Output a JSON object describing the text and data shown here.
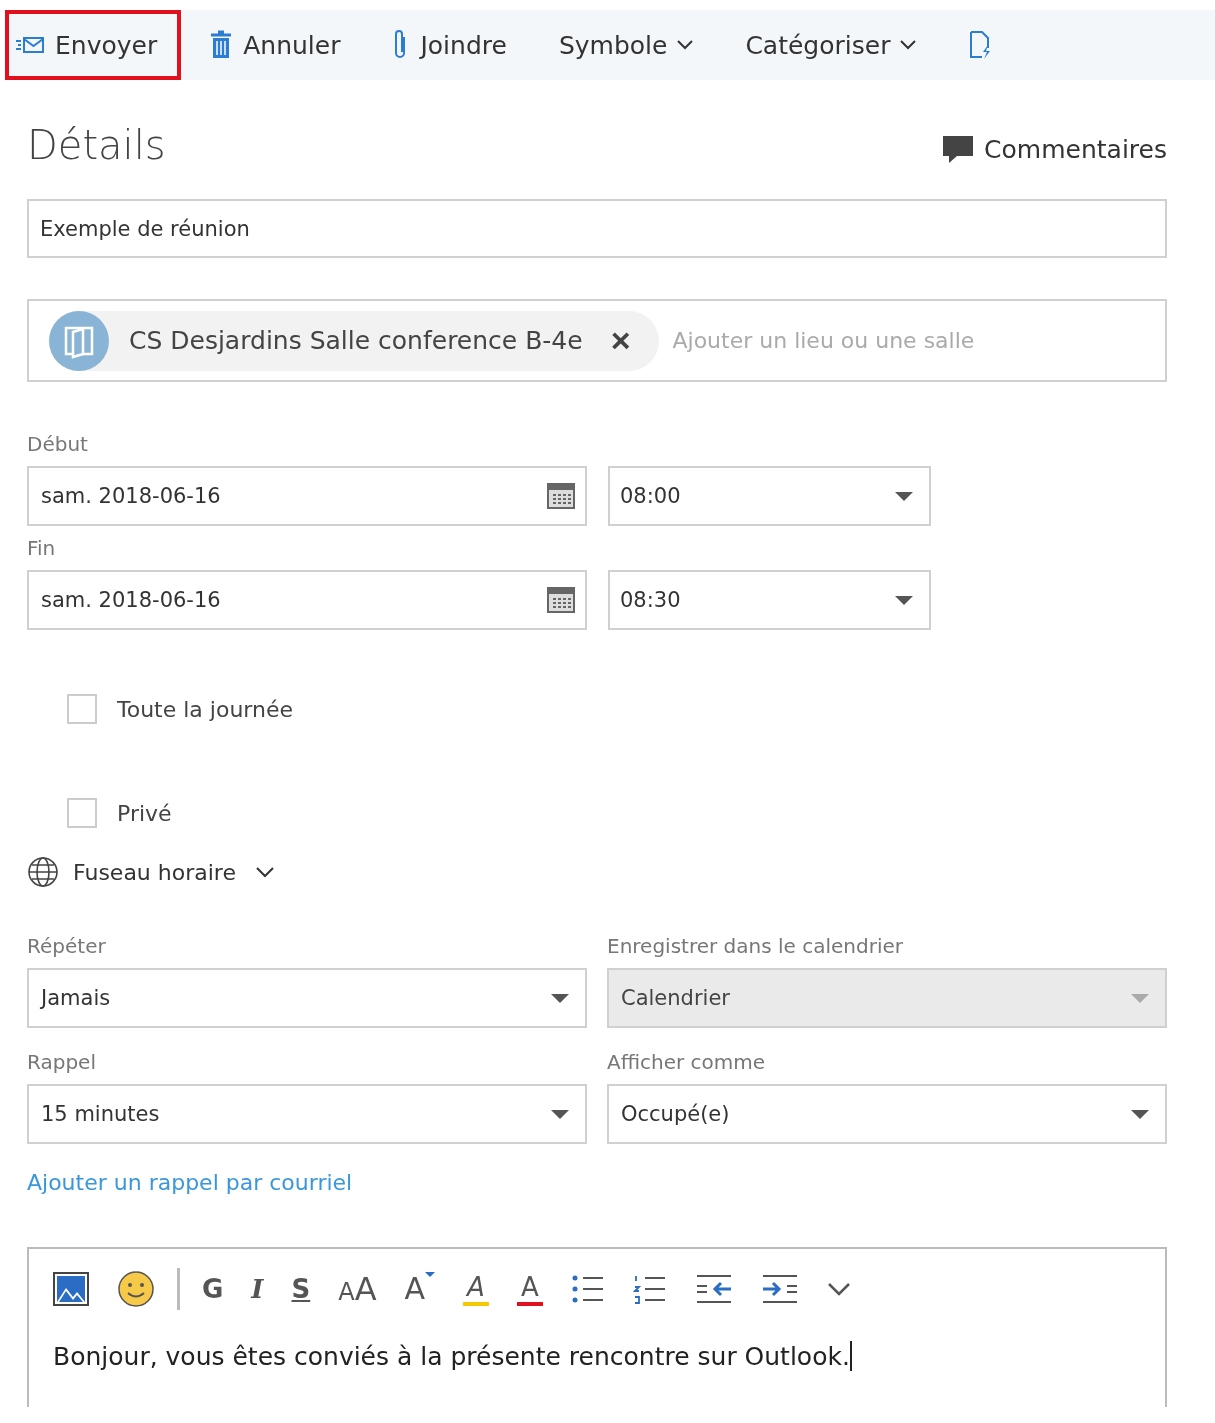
{
  "toolbar": [
    {
      "kind": "send",
      "label": "Envoyer",
      "highlighted": true
    },
    {
      "kind": "discard",
      "label": "Annuler",
      "highlighted": false
    },
    {
      "kind": "attach",
      "label": "Joindre",
      "highlighted": false
    },
    {
      "kind": "menu",
      "label": "Symbole",
      "highlighted": false
    },
    {
      "kind": "menu",
      "label": "Catégoriser",
      "highlighted": false
    },
    {
      "kind": "addin",
      "highlighted": false
    }
  ],
  "details": {
    "title": "Détails",
    "comments": "Commentaires"
  },
  "subject": {
    "value": "Exemple de réunion"
  },
  "location": {
    "chip": "CS Desjardins Salle conference B-4e",
    "remove": "×",
    "placeholder": "Ajouter un lieu ou une salle"
  },
  "start": {
    "label": "Début",
    "date": "sam. 2018-06-16",
    "time": "08:00"
  },
  "end": {
    "label": "Fin",
    "date": "sam. 2018-06-16",
    "time": "08:30"
  },
  "checkboxes": [
    {
      "label": "Toute la journée",
      "checked": false
    },
    {
      "label": "Privé",
      "checked": false
    }
  ],
  "timezone": {
    "label": "Fuseau horaire"
  },
  "selects": [
    {
      "label": "Répéter",
      "value": "Jamais",
      "disabled": false
    },
    {
      "label": "Enregistrer dans le calendrier",
      "value": "Calendrier",
      "disabled": true
    },
    {
      "label": "Rappel",
      "value": "15 minutes",
      "disabled": false
    },
    {
      "label": "Afficher comme",
      "value": "Occupé(e)",
      "disabled": false
    }
  ],
  "email_reminder_link": "Ajouter un rappel par courriel",
  "editor": {
    "insert_tools": [
      {
        "kind": "image"
      },
      {
        "kind": "emoji"
      }
    ],
    "format_tools": [
      {
        "kind": "bold",
        "glyph": "G"
      },
      {
        "kind": "italic",
        "glyph": "I"
      },
      {
        "kind": "strike",
        "glyph": "S"
      },
      {
        "kind": "size",
        "glyph": "AA"
      },
      {
        "kind": "grow",
        "glyph": "A"
      },
      {
        "kind": "highlight",
        "glyph": "A"
      },
      {
        "kind": "color",
        "glyph": "A"
      },
      {
        "kind": "bullets"
      },
      {
        "kind": "numbering"
      },
      {
        "kind": "outdent"
      },
      {
        "kind": "indent"
      },
      {
        "kind": "more"
      }
    ],
    "body": "Bonjour, vous êtes conviés à la présente rencontre sur Outlook."
  }
}
